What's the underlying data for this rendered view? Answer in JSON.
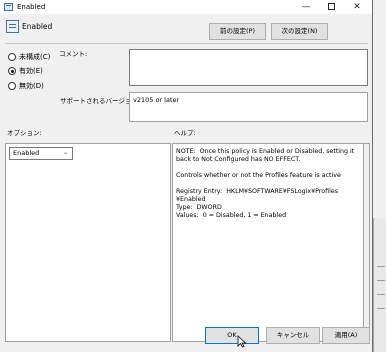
{
  "window": {
    "title": "Enabled",
    "minimize": "—",
    "close": "✕"
  },
  "header": {
    "title": "Enabled",
    "prev_button": "前の設定(P)",
    "next_button": "次の設定(N)"
  },
  "state": {
    "not_configured": "未構成(C)",
    "enabled": "有効(E)",
    "disabled": "無効(D)",
    "selected": "enabled"
  },
  "comment": {
    "label": "コメント:",
    "value": ""
  },
  "supported": {
    "label": "サポートされるバージョン:",
    "value": "v2105 or later"
  },
  "options": {
    "label": "オプション:",
    "selected": "Enabled"
  },
  "help": {
    "label": "ヘルプ:",
    "text": "NOTE:  Once this policy is Enabled or Disabled, setting it back to Not Configured has NO EFFECT.\n\nControls whether or not the Profiles feature is active\n\nRegistry Entry:  HKLM¥SOFTWARE¥FSLogix¥Profiles ¥Enabled\nType:  DWORD\nValues:  0 = Disabled, 1 = Enabled"
  },
  "footer": {
    "ok": "OK",
    "cancel": "キャンセル",
    "apply": "適用(A)"
  }
}
